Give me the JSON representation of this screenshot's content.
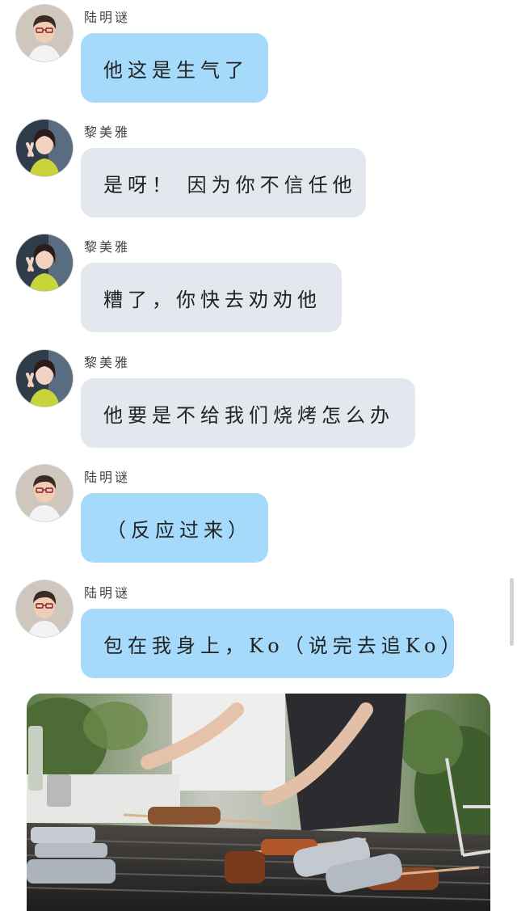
{
  "messages": [
    {
      "sender": "陆明谜",
      "text": "他这是生气了",
      "style": "blue",
      "avatar": "male-avatar"
    },
    {
      "sender": "黎美雅",
      "text": "是呀！ 因为你不信任他",
      "style": "gray",
      "avatar": "female-avatar"
    },
    {
      "sender": "黎美雅",
      "text": "糟了，你快去劝劝他",
      "style": "gray",
      "avatar": "female-avatar"
    },
    {
      "sender": "黎美雅",
      "text": "他要是不给我们烧烤怎么办",
      "style": "gray",
      "avatar": "female-avatar"
    },
    {
      "sender": "陆明谜",
      "text": "（反应过来）",
      "style": "blue",
      "avatar": "male-avatar"
    },
    {
      "sender": "陆明谜",
      "text": "包在我身上，Ko（说完去追Ko）",
      "style": "blue",
      "avatar": "male-avatar"
    }
  ],
  "colors": {
    "blue_bubble": "#a5dafb",
    "gray_bubble": "#e3e7ee",
    "background": "#ffffff"
  },
  "photo": {
    "subject": "barbecue-grill-photo"
  }
}
